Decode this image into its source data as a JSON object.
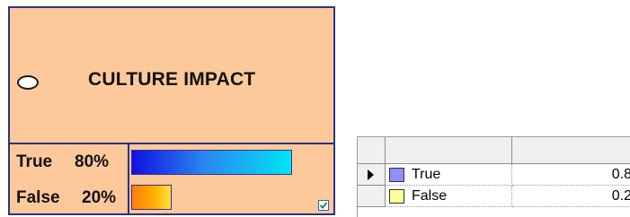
{
  "node": {
    "title": "CULTURE IMPACT",
    "states": [
      {
        "label": "True",
        "percent": "80%",
        "probability": 0.8,
        "color": "#1e6cf0"
      },
      {
        "label": "False",
        "percent": "20%",
        "probability": 0.2,
        "color": "#ffa000"
      }
    ],
    "indicator_icon": "oval-state-icon",
    "checkbox_checked": true,
    "colors": {
      "fill": "#fdc99b",
      "border": "#2a3384"
    }
  },
  "table": {
    "columns": [
      "",
      ""
    ],
    "rows": [
      {
        "state": "True",
        "value": "0.8",
        "swatch_color": "#8f8fff",
        "selected": true
      },
      {
        "state": "False",
        "value": "0.2",
        "swatch_color": "#ffff99",
        "selected": false
      }
    ]
  }
}
